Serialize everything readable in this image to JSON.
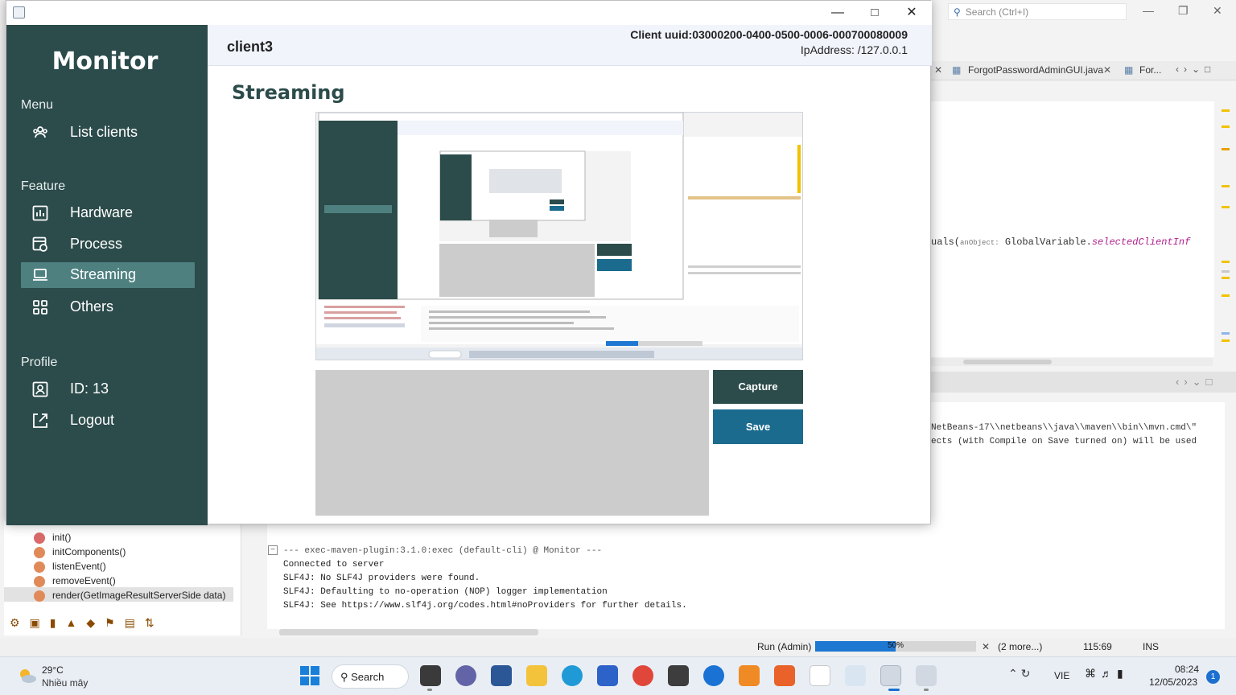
{
  "monitor_window": {
    "sidebar": {
      "app_title": "Monitor",
      "menu_section": "Menu",
      "menu_items": [
        {
          "label": "List clients",
          "icon": "users-icon"
        }
      ],
      "feature_section": "Feature",
      "feature_items": [
        {
          "label": "Hardware",
          "icon": "bar-chart-icon"
        },
        {
          "label": "Process",
          "icon": "process-icon"
        },
        {
          "label": "Streaming",
          "icon": "laptop-icon",
          "active": true
        },
        {
          "label": "Others",
          "icon": "grid-icon"
        }
      ],
      "profile_section": "Profile",
      "profile_items": [
        {
          "label": "ID: 13",
          "icon": "id-card-icon"
        },
        {
          "label": "Logout",
          "icon": "logout-icon"
        }
      ]
    },
    "header": {
      "client_name": "client3",
      "client_uuid": "Client uuid:03000200-0400-0500-0006-000700080009",
      "ip_address": "IpAddress: /127.0.0.1"
    },
    "main": {
      "heading": "Streaming",
      "capture_button": "Capture",
      "save_button": "Save"
    },
    "colors": {
      "sidebar": "#2c4b4b",
      "sidebar_active": "#4f8080",
      "capture_button": "#2c4b4b",
      "save_button": "#1b6b8f"
    }
  },
  "ide": {
    "search_placeholder": "Search (Ctrl+I)",
    "tabs": [
      "ForgotPasswordAdminGUI.java",
      "For..."
    ],
    "code_line": {
      "pre": "uals(",
      "hint": "anObject:",
      "mid": " GlobalVariable.",
      "field": "selectedClientInf"
    },
    "output_lines": [
      "NetBeans-17\\\\netbeans\\\\java\\\\maven\\\\bin\\\\mvn.cmd\\\"",
      "ects (with Compile on Save turned on) will be used"
    ],
    "console_lines": [
      "--- exec-maven-plugin:3.1.0:exec (default-cli) @ Monitor ---",
      "Connected to server",
      "SLF4J: No SLF4J providers were found.",
      "SLF4J: Defaulting to no-operation (NOP) logger implementation",
      "SLF4J: See https://www.slf4j.org/codes.html#noProviders for further details."
    ],
    "navigator_items": [
      "init()",
      "initComponents()",
      "listenEvent()",
      "removeEvent()",
      "render(GetImageResultServerSide data)"
    ],
    "status": {
      "run_label": "Run (Admin)",
      "progress_percent": 50,
      "progress_text": "50%",
      "more": "(2 more...)",
      "position": "115:69",
      "mode": "INS"
    }
  },
  "taskbar": {
    "weather_temp": "29°C",
    "weather_desc": "Nhiều mây",
    "search_label": "Search",
    "language": "VIE",
    "time": "08:24",
    "date": "12/05/2023",
    "notification_count": "1"
  }
}
